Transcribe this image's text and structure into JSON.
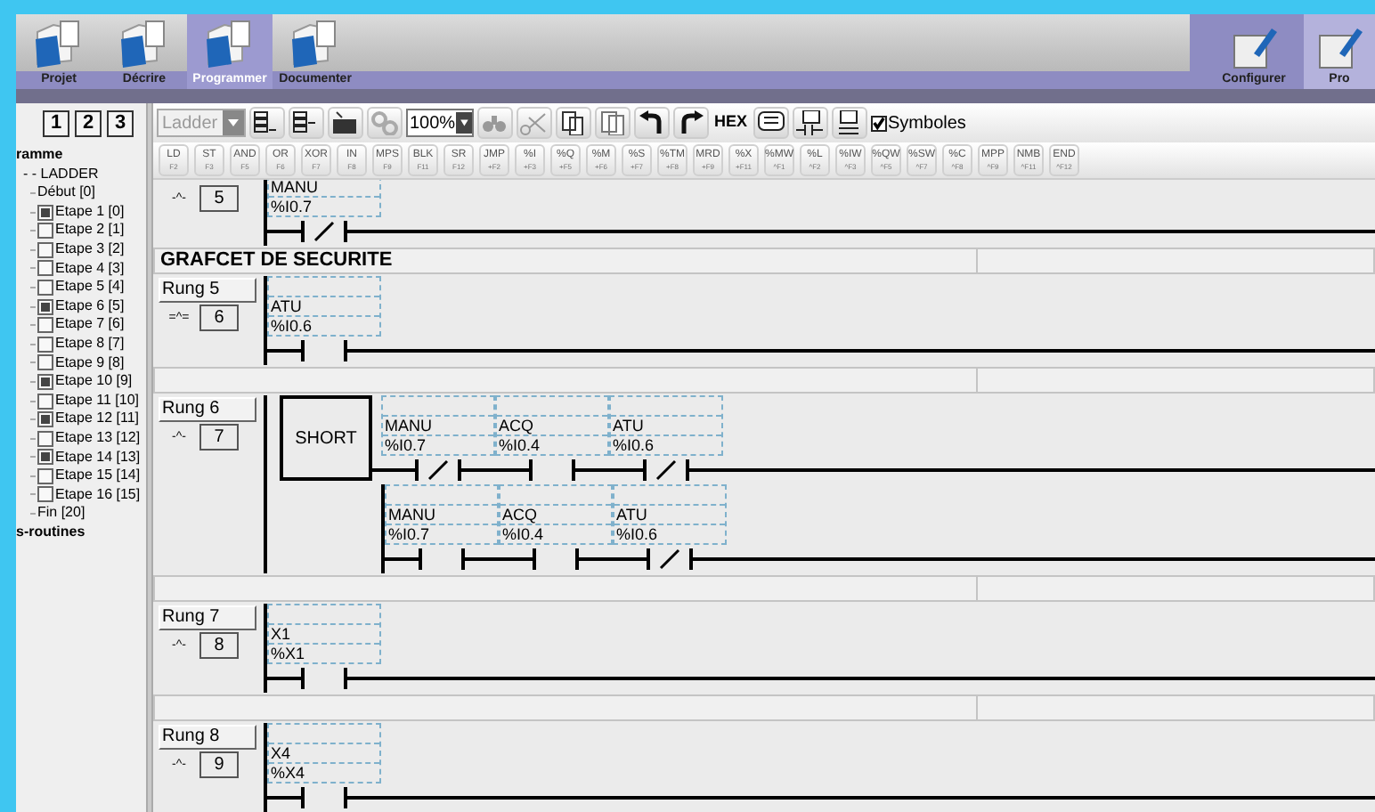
{
  "top_tabs": [
    {
      "label": "Projet",
      "selected": false
    },
    {
      "label": "Décrire",
      "selected": false
    },
    {
      "label": "Programmer",
      "selected": true
    },
    {
      "label": "Documenter",
      "selected": false
    }
  ],
  "right_tabs": [
    {
      "label": "Configurer",
      "selected": false
    },
    {
      "label": "Pro",
      "selected": true
    }
  ],
  "sheet_buttons": [
    "1",
    "2",
    "3"
  ],
  "tree": {
    "label": "ramme",
    "children": [
      {
        "label": "- - LADDER",
        "children": [
          {
            "label": "Début [0]",
            "kind": "plain"
          },
          {
            "label": "Etape 1 [0]",
            "kind": "step",
            "marked": true
          },
          {
            "label": "Etape 2 [1]",
            "kind": "step",
            "marked": false
          },
          {
            "label": "Etape 3 [2]",
            "kind": "step",
            "marked": false
          },
          {
            "label": "Etape 4 [3]",
            "kind": "step",
            "marked": false
          },
          {
            "label": "Etape 5 [4]",
            "kind": "step",
            "marked": false
          },
          {
            "label": "Etape 6 [5]",
            "kind": "step",
            "marked": true
          },
          {
            "label": "Etape 7 [6]",
            "kind": "step",
            "marked": false
          },
          {
            "label": "Etape 8 [7]",
            "kind": "step",
            "marked": false
          },
          {
            "label": "Etape 9 [8]",
            "kind": "step",
            "marked": false
          },
          {
            "label": "Etape 10 [9]",
            "kind": "step",
            "marked": true
          },
          {
            "label": "Etape 11 [10]",
            "kind": "step",
            "marked": false
          },
          {
            "label": "Etape 12 [11]",
            "kind": "step",
            "marked": true
          },
          {
            "label": "Etape 13 [12]",
            "kind": "step",
            "marked": false
          },
          {
            "label": "Etape 14 [13]",
            "kind": "step",
            "marked": true
          },
          {
            "label": "Etape 15 [14]",
            "kind": "step",
            "marked": false
          },
          {
            "label": "Etape 16 [15]",
            "kind": "step",
            "marked": false
          },
          {
            "label": "Fin [20]",
            "kind": "plain"
          }
        ]
      }
    ]
  },
  "subroutines": "s-routines",
  "toolbar": {
    "language": {
      "value": "Ladder",
      "disabled": true
    },
    "zoom": "100%",
    "hex": "HEX",
    "symbols": {
      "label": "Symboles",
      "checked": true
    }
  },
  "instructions": [
    {
      "label": "LD",
      "key": "F2"
    },
    {
      "label": "ST",
      "key": "F3"
    },
    {
      "label": "AND",
      "key": "F5"
    },
    {
      "label": "OR",
      "key": "F6"
    },
    {
      "label": "XOR",
      "key": "F7"
    },
    {
      "label": "IN",
      "key": "F8"
    },
    {
      "label": "MPS",
      "key": "F9"
    },
    {
      "label": "BLK",
      "key": "F11"
    },
    {
      "label": "SR",
      "key": "F12"
    },
    {
      "label": "JMP",
      "key": "+F2"
    },
    {
      "label": "%I",
      "key": "+F3"
    },
    {
      "label": "%Q",
      "key": "+F5"
    },
    {
      "label": "%M",
      "key": "+F6"
    },
    {
      "label": "%S",
      "key": "+F7"
    },
    {
      "label": "%TM",
      "key": "+F8"
    },
    {
      "label": "MRD",
      "key": "+F9"
    },
    {
      "label": "%X",
      "key": "+F11"
    },
    {
      "label": "%MW",
      "key": "^F1"
    },
    {
      "label": "%L",
      "key": "^F2"
    },
    {
      "label": "%IW",
      "key": "^F3"
    },
    {
      "label": "%QW",
      "key": "^F5"
    },
    {
      "label": "%SW",
      "key": "^F7"
    },
    {
      "label": "%C",
      "key": "^F8"
    },
    {
      "label": "MPP",
      "key": "^F9"
    },
    {
      "label": "NMB",
      "key": "^F11"
    },
    {
      "label": "END",
      "key": "^F12"
    }
  ],
  "ladder": [
    {
      "kind": "rung",
      "mode": "-^-",
      "number": "5",
      "branches": [
        [
          {
            "kind": "normally_closed",
            "symbol": "MANU",
            "address": "%I0.7"
          }
        ]
      ]
    },
    {
      "kind": "section",
      "title": "GRAFCET DE SECURITE"
    },
    {
      "kind": "rung",
      "label": "Rung 5",
      "mode": "=^=",
      "number": "6",
      "branches": [
        [
          {
            "kind": "normally_open",
            "symbol": "ATU",
            "address": "%I0.6"
          }
        ]
      ]
    },
    {
      "kind": "separator"
    },
    {
      "kind": "rung",
      "label": "Rung 6",
      "mode": "-^-",
      "number": "7",
      "block": "SHORT",
      "branches": [
        [
          {
            "kind": "normally_closed",
            "symbol": "MANU",
            "address": "%I0.7"
          },
          {
            "kind": "normally_open",
            "symbol": "ACQ",
            "address": "%I0.4"
          },
          {
            "kind": "normally_closed",
            "symbol": "ATU",
            "address": "%I0.6"
          }
        ],
        [
          {
            "kind": "normally_open",
            "symbol": "MANU",
            "address": "%I0.7"
          },
          {
            "kind": "normally_open",
            "symbol": "ACQ",
            "address": "%I0.4"
          },
          {
            "kind": "normally_closed",
            "symbol": "ATU",
            "address": "%I0.6"
          }
        ]
      ]
    },
    {
      "kind": "separator"
    },
    {
      "kind": "rung",
      "label": "Rung 7",
      "mode": "-^-",
      "number": "8",
      "branches": [
        [
          {
            "kind": "normally_open",
            "symbol": "X1",
            "address": "%X1"
          }
        ]
      ]
    },
    {
      "kind": "separator"
    },
    {
      "kind": "rung",
      "label": "Rung 8",
      "mode": "-^-",
      "number": "9",
      "branches": [
        [
          {
            "kind": "normally_open",
            "symbol": "X4",
            "address": "%X4"
          }
        ]
      ]
    }
  ]
}
